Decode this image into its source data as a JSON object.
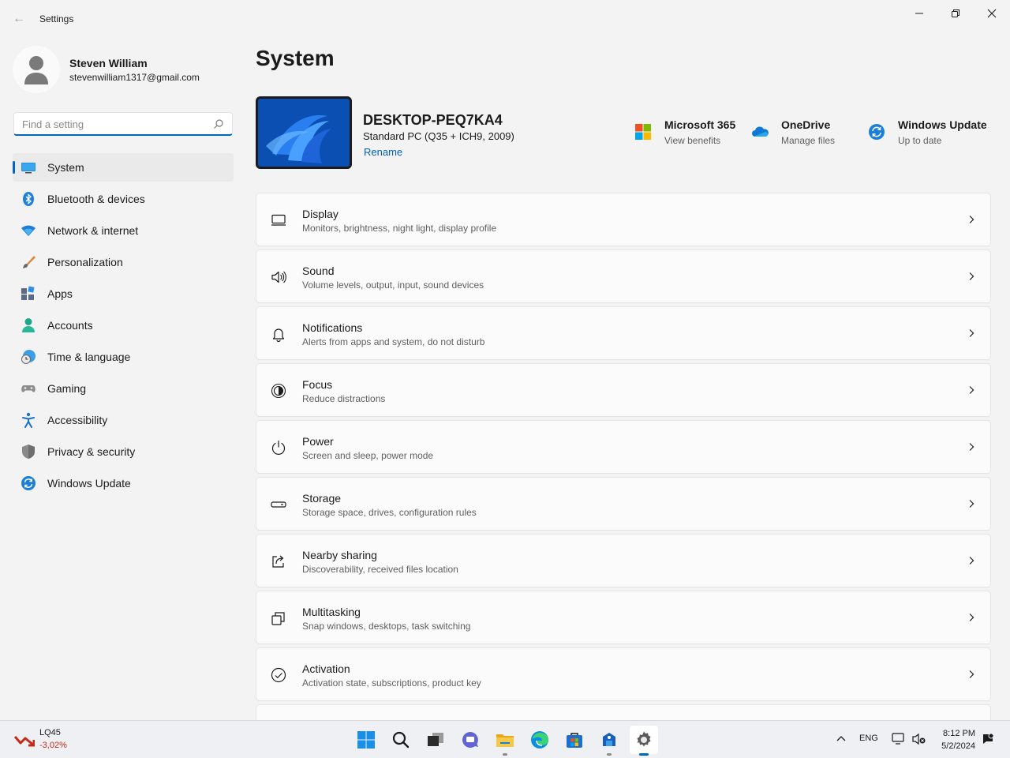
{
  "window": {
    "title": "Settings"
  },
  "profile": {
    "name": "Steven William",
    "email": "stevenwilliam1317@gmail.com"
  },
  "search": {
    "placeholder": "Find a setting"
  },
  "nav": [
    {
      "label": "System",
      "icon": "system-icon",
      "selected": true
    },
    {
      "label": "Bluetooth & devices",
      "icon": "bluetooth-icon"
    },
    {
      "label": "Network & internet",
      "icon": "wifi-icon"
    },
    {
      "label": "Personalization",
      "icon": "brush-icon"
    },
    {
      "label": "Apps",
      "icon": "apps-icon"
    },
    {
      "label": "Accounts",
      "icon": "person-icon"
    },
    {
      "label": "Time & language",
      "icon": "clock-globe-icon"
    },
    {
      "label": "Gaming",
      "icon": "gamepad-icon"
    },
    {
      "label": "Accessibility",
      "icon": "accessibility-icon"
    },
    {
      "label": "Privacy & security",
      "icon": "shield-icon"
    },
    {
      "label": "Windows Update",
      "icon": "update-icon"
    }
  ],
  "page": {
    "title": "System"
  },
  "device": {
    "name": "DESKTOP-PEQ7KA4",
    "spec": "Standard PC (Q35 + ICH9, 2009)",
    "rename": "Rename"
  },
  "tiles": [
    {
      "title": "Microsoft 365",
      "sub": "View benefits",
      "icon": "microsoft-365-icon"
    },
    {
      "title": "OneDrive",
      "sub": "Manage files",
      "icon": "onedrive-icon"
    },
    {
      "title": "Windows Update",
      "sub": "Up to date",
      "icon": "windows-update-icon"
    }
  ],
  "cards": [
    {
      "title": "Display",
      "sub": "Monitors, brightness, night light, display profile",
      "icon": "display-icon"
    },
    {
      "title": "Sound",
      "sub": "Volume levels, output, input, sound devices",
      "icon": "speaker-icon"
    },
    {
      "title": "Notifications",
      "sub": "Alerts from apps and system, do not disturb",
      "icon": "bell-icon"
    },
    {
      "title": "Focus",
      "sub": "Reduce distractions",
      "icon": "focus-icon"
    },
    {
      "title": "Power",
      "sub": "Screen and sleep, power mode",
      "icon": "power-icon"
    },
    {
      "title": "Storage",
      "sub": "Storage space, drives, configuration rules",
      "icon": "storage-icon"
    },
    {
      "title": "Nearby sharing",
      "sub": "Discoverability, received files location",
      "icon": "share-icon"
    },
    {
      "title": "Multitasking",
      "sub": "Snap windows, desktops, task switching",
      "icon": "multitask-icon"
    },
    {
      "title": "Activation",
      "sub": "Activation state, subscriptions, product key",
      "icon": "check-circle-icon"
    }
  ],
  "taskbar": {
    "widget": {
      "symbol": "LQ45",
      "value": "-3,02%"
    },
    "apps": [
      "start-icon",
      "search-icon",
      "task-view-icon",
      "teams-chat-icon",
      "file-explorer-icon",
      "edge-icon",
      "store-icon",
      "app-icon",
      "settings-gear-icon"
    ],
    "language": "ENG",
    "time": "8:12 PM",
    "date": "5/2/2024"
  },
  "colors": {
    "accent": "#0067c0",
    "link": "#005fb8",
    "negative": "#c42b1c"
  }
}
